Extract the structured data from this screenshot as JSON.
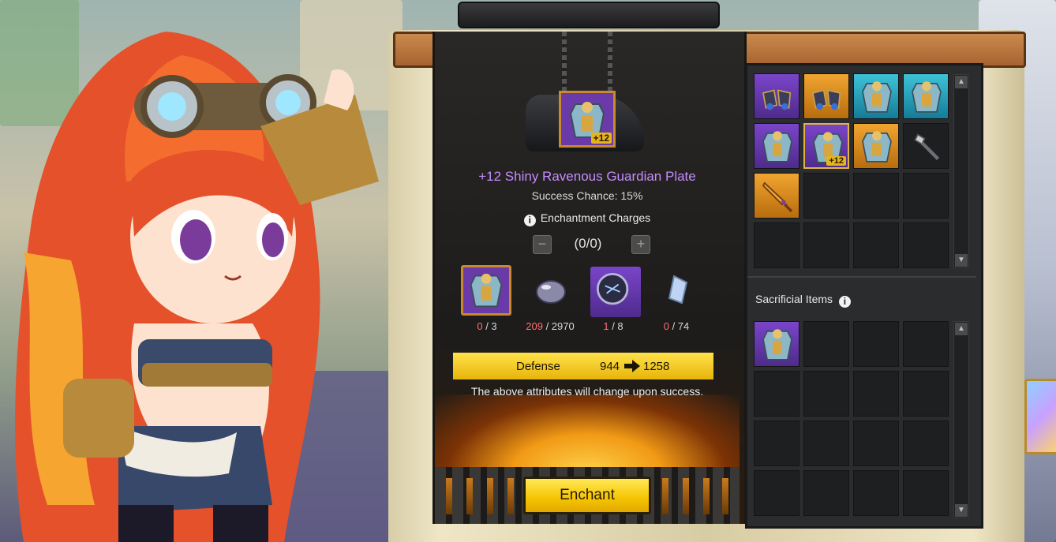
{
  "item": {
    "name": "+12 Shiny Ravenous Guardian Plate",
    "badge": "+12",
    "success_chance": "Success Chance: 15%"
  },
  "charges": {
    "label": "Enchantment Charges",
    "info_glyph": "i",
    "value": "(0/0)",
    "minus": "−",
    "plus": "+"
  },
  "materials": [
    {
      "icon": "guardian-plate-icon",
      "have": "0",
      "need": "/ 3",
      "have_color": "#ff6f6f"
    },
    {
      "icon": "onyx-crystal-icon",
      "have": "209",
      "need": "/ 2970",
      "have_color": "#ff6f6f"
    },
    {
      "icon": "chaos-onyx-icon",
      "have": "1",
      "need": "/ 8",
      "have_color": "#ff6f6f"
    },
    {
      "icon": "crystal-fragment-icon",
      "have": "0",
      "need": "/ 74",
      "have_color": "#ff6f6f"
    }
  ],
  "attribute": {
    "name": "Defense",
    "from": "944",
    "to": "1258"
  },
  "note": "The above attributes will change upon success.",
  "enchant_button": "Enchant",
  "inventory": {
    "slots": [
      {
        "rarity": "purple",
        "icon": "boots-icon",
        "badge": ""
      },
      {
        "rarity": "gold",
        "icon": "boots-icon",
        "badge": ""
      },
      {
        "rarity": "blue",
        "icon": "guardian-plate-icon",
        "badge": ""
      },
      {
        "rarity": "blue",
        "icon": "guardian-plate-icon",
        "badge": ""
      },
      {
        "rarity": "purple",
        "icon": "guardian-plate-icon",
        "badge": ""
      },
      {
        "rarity": "purple",
        "icon": "guardian-plate-icon",
        "badge": "+12",
        "selected": true
      },
      {
        "rarity": "gold",
        "icon": "guardian-plate-icon",
        "badge": ""
      },
      {
        "rarity": "empty",
        "icon": "mace-icon",
        "badge": ""
      },
      {
        "rarity": "gold",
        "icon": "sword-icon",
        "badge": ""
      },
      {
        "rarity": "empty",
        "icon": "",
        "badge": ""
      },
      {
        "rarity": "empty",
        "icon": "",
        "badge": ""
      },
      {
        "rarity": "empty",
        "icon": "",
        "badge": ""
      },
      {
        "rarity": "empty",
        "icon": "",
        "badge": ""
      },
      {
        "rarity": "empty",
        "icon": "",
        "badge": ""
      },
      {
        "rarity": "empty",
        "icon": "",
        "badge": ""
      },
      {
        "rarity": "empty",
        "icon": "",
        "badge": ""
      }
    ]
  },
  "sacrificial": {
    "label": "Sacrificial Items",
    "info_glyph": "i",
    "slots": [
      {
        "rarity": "purple",
        "icon": "guardian-plate-icon"
      }
    ]
  },
  "scroll_up": "▲",
  "scroll_down": "▼",
  "colors": {
    "epic_purple": "#c58cff",
    "gold_bar": "#ffe24b",
    "shortage_red": "#ff6f6f"
  }
}
